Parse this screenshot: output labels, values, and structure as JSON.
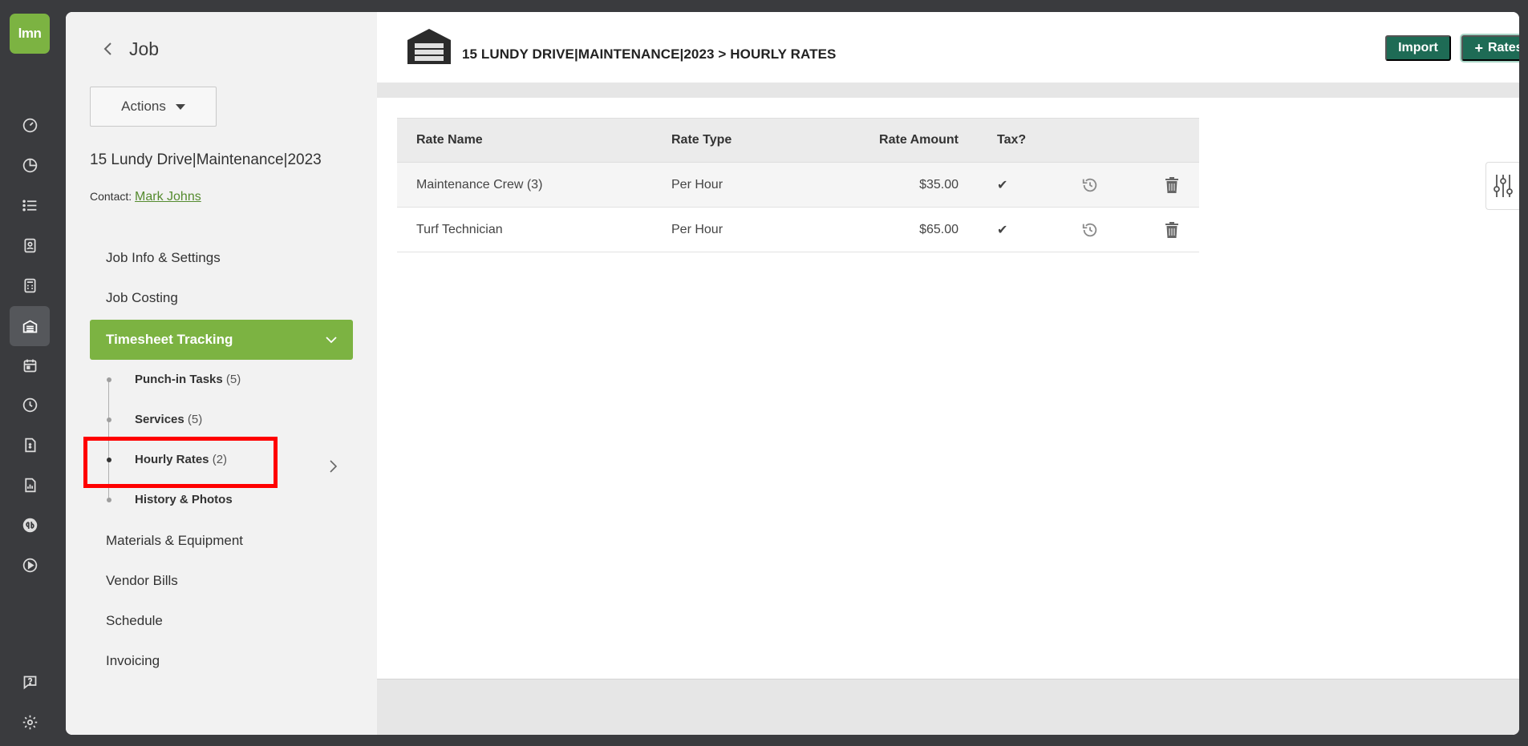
{
  "rail": {
    "logo_text": "lmn",
    "icons": [
      "dashboard-icon",
      "chart-icon",
      "list-icon",
      "contacts-icon",
      "calculator-icon",
      "garage-icon",
      "calendar-icon",
      "clock-icon",
      "invoice-icon",
      "report-icon",
      "quickbooks-icon",
      "play-icon",
      "help-icon",
      "settings-icon"
    ],
    "active": "garage-icon"
  },
  "sidebar": {
    "title": "Job",
    "actions_label": "Actions",
    "job_name": "15 Lundy Drive|Maintenance|2023",
    "contact_label": "Contact:",
    "contact_name": "Mark Johns",
    "nav": {
      "job_info": "Job Info & Settings",
      "job_costing": "Job Costing",
      "timesheet": "Timesheet Tracking",
      "materials": "Materials & Equipment",
      "vendor_bills": "Vendor Bills",
      "schedule": "Schedule",
      "invoicing": "Invoicing"
    },
    "sub": {
      "punch": "Punch-in Tasks",
      "punch_count": "(5)",
      "services": "Services",
      "services_count": "(5)",
      "hourly": "Hourly Rates",
      "hourly_count": "(2)",
      "history": "History & Photos"
    }
  },
  "header": {
    "breadcrumb": "15 LUNDY DRIVE|MAINTENANCE|2023 > HOURLY RATES",
    "import_label": "Import",
    "rates_label": "Rates",
    "rates_plus": "+"
  },
  "table": {
    "columns": {
      "name": "Rate Name",
      "type": "Rate Type",
      "amount": "Rate Amount",
      "tax": "Tax?"
    },
    "rows": [
      {
        "name": "Maintenance Crew (3)",
        "type": "Per Hour",
        "amount": "$35.00",
        "tax": "✔"
      },
      {
        "name": "Turf Technician",
        "type": "Per Hour",
        "amount": "$65.00",
        "tax": "✔"
      }
    ]
  },
  "colors": {
    "brand_green": "#7cb342",
    "button_teal": "#1e6b55",
    "highlight_red": "#ff0000"
  }
}
